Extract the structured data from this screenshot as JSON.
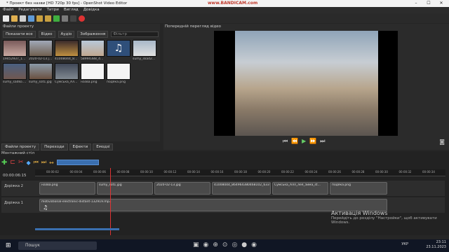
{
  "window": {
    "title": "* Проект без назви [HD 720p 30 fps] - OpenShot Video Editor",
    "watermark": "www.BANDICAM.com"
  },
  "menu": [
    "Файл",
    "Редагувати",
    "Титри",
    "Вигляд",
    "Довідка"
  ],
  "files_panel": {
    "title": "Файли проекту",
    "tabs": [
      "Показати все",
      "Відео",
      "Аудіо",
      "Зображення"
    ],
    "filter_placeholder": "Фільтр",
    "items": [
      {
        "label": "19452937_1546..."
      },
      {
        "label": "2020-02-13.jpg"
      },
      {
        "label": "41008044_86..."
      },
      {
        "label": "58994388_44..."
      },
      {
        "label": ""
      },
      {
        "label": "sumy_skad2..."
      },
      {
        "label": "sumy_sadko.j..."
      },
      {
        "label": "sumy_sot1.jpg"
      },
      {
        "label": "Сумська_Алл..."
      },
      {
        "label": "назва.png"
      },
      {
        "label": "подяка.png"
      }
    ]
  },
  "preview": {
    "title": "Попередній перегляд відео"
  },
  "bottom_tabs": [
    "Файли проекту",
    "Переходи",
    "Ефекти",
    "Емодзі"
  ],
  "timeline": {
    "title": "Монтажний стіл",
    "timecode": "00:00:06:15",
    "ruler_ticks": [
      "00:00:02",
      "00:00:04",
      "00:00:06",
      "00:00:08",
      "00:00:10",
      "00:00:12",
      "00:00:14",
      "00:00:16",
      "00:00:18",
      "00:00:20",
      "00:00:22",
      "00:00:24",
      "00:00:26",
      "00:00:28",
      "00:00:30",
      "00:00:32",
      "00:00:34"
    ],
    "tracks": [
      {
        "name": "Доріжка 2",
        "clips": [
          "назва.png",
          "sumy_sot1.jpg",
          "2020-02-13.jpg",
          "41008044_864964380468102_633891...",
          "Сумська_Алл_лея_зима_st...",
          "подяка.png"
        ]
      },
      {
        "name": "Доріжка 1",
        "clips": [
          "motivational-electronic-distant-132919.mp3"
        ]
      }
    ]
  },
  "activation": {
    "title": "Активація Windows",
    "text": "Перейдіть до розділу \"Настройки\", щоб активувати Windows."
  },
  "taskbar": {
    "search": "Пошук",
    "time": "23:11",
    "date": "23.11.2023",
    "lang": "УКР"
  }
}
